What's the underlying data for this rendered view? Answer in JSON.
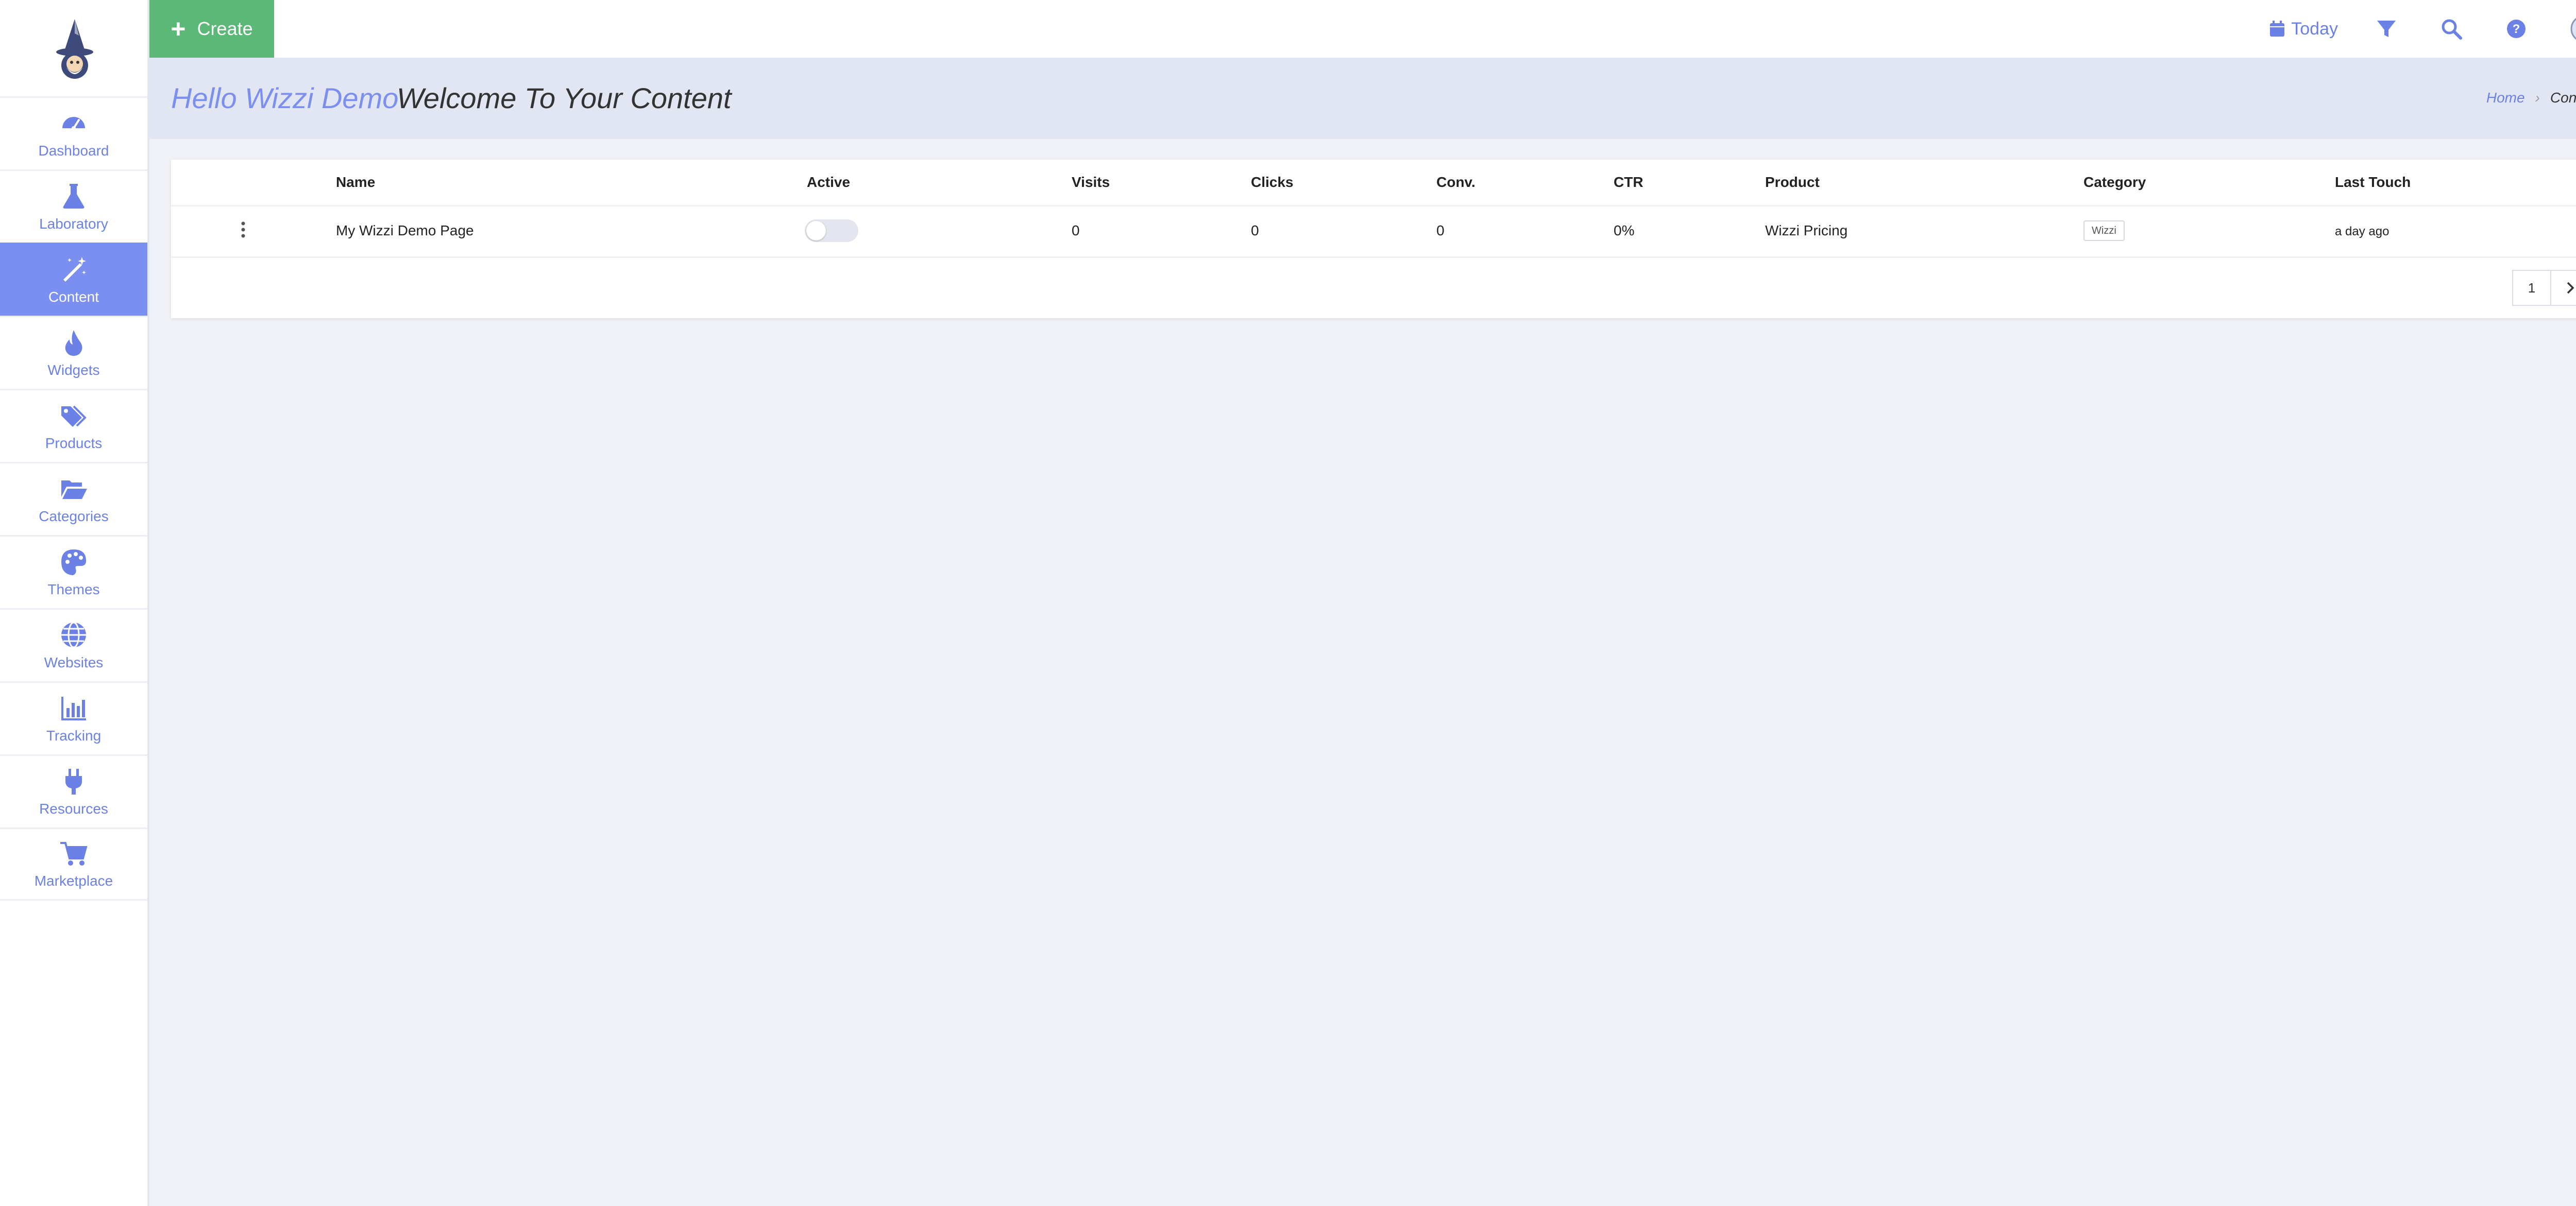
{
  "sidebar": {
    "logo_icon": "wizard-logo",
    "items": [
      {
        "label": "Dashboard",
        "icon": "dashboard-gauge-icon"
      },
      {
        "label": "Laboratory",
        "icon": "flask-icon"
      },
      {
        "label": "Content",
        "icon": "magic-wand-icon",
        "active": true
      },
      {
        "label": "Widgets",
        "icon": "fire-icon"
      },
      {
        "label": "Products",
        "icon": "tags-icon"
      },
      {
        "label": "Categories",
        "icon": "folder-open-icon"
      },
      {
        "label": "Themes",
        "icon": "palette-icon"
      },
      {
        "label": "Websites",
        "icon": "globe-icon"
      },
      {
        "label": "Tracking",
        "icon": "bar-chart-icon"
      },
      {
        "label": "Resources",
        "icon": "plug-icon"
      },
      {
        "label": "Marketplace",
        "icon": "cart-icon"
      }
    ]
  },
  "topbar": {
    "create_label": "Create",
    "today_label": "Today",
    "icons": [
      "calendar-icon",
      "filter-icon",
      "search-icon",
      "help-icon",
      "user-avatar-icon"
    ]
  },
  "header": {
    "hello": "Hello Wizzi Demo",
    "welcome": "Welcome To Your Content",
    "breadcrumb": {
      "home": "Home",
      "separator": "›",
      "current": "Content"
    }
  },
  "table": {
    "columns": [
      "Name",
      "Active",
      "Visits",
      "Clicks",
      "Conv.",
      "CTR",
      "Product",
      "Category",
      "Last Touch"
    ],
    "rows": [
      {
        "name": "My Wizzi Demo Page",
        "active": false,
        "visits": "0",
        "clicks": "0",
        "conv": "0",
        "ctr": "0%",
        "product": "Wizzi Pricing",
        "category": "Wizzi",
        "last_touch": "a day ago"
      }
    ]
  },
  "pagination": {
    "current_page": "1",
    "next_icon": "chevron-right-icon"
  },
  "colors": {
    "accent": "#7b8ff0",
    "create_green": "#5cb876",
    "header_band": "#e1e6f2",
    "page_bg": "#eff1f6"
  }
}
